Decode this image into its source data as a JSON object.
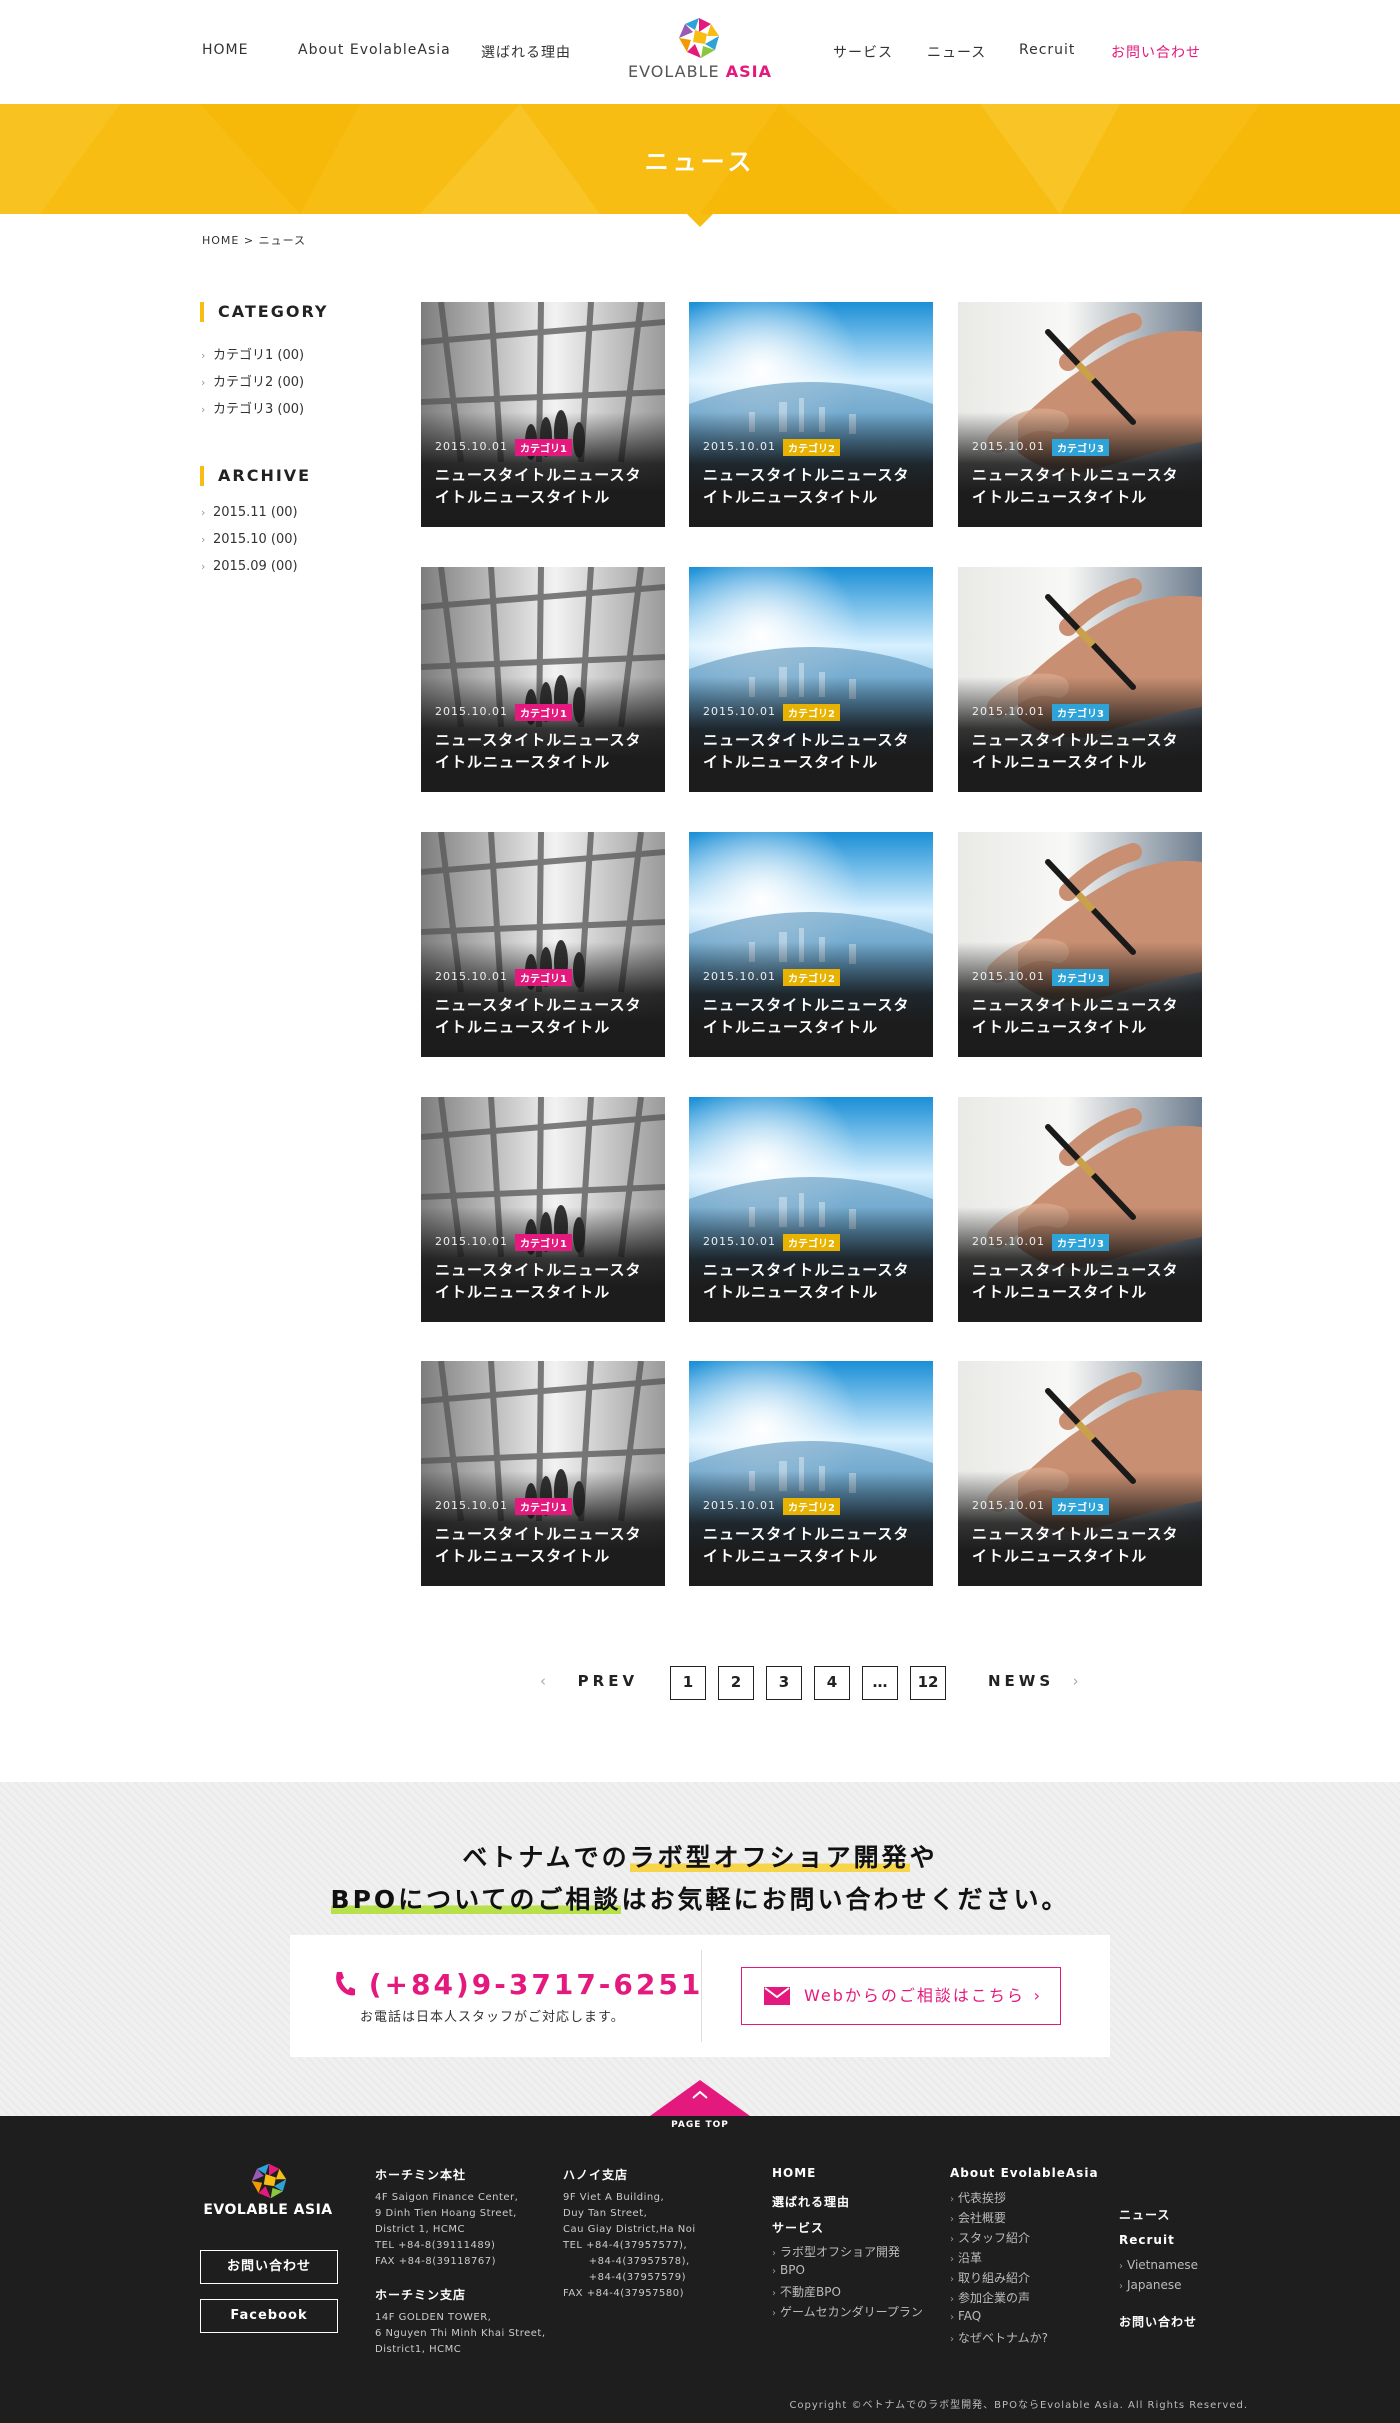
{
  "header": {
    "nav_left": [
      "HOME",
      "About EvolableAsia",
      "選ばれる理由"
    ],
    "nav_right": [
      "サービス",
      "ニュース",
      "Recruit",
      "お問い合わせ"
    ],
    "logo": {
      "text_main": "EVOLABLE",
      "text_accent": "ASIA"
    }
  },
  "hero": {
    "title": "ニュース"
  },
  "breadcrumb": "HOME > ニュース",
  "sidebar": {
    "category_title": "CATEGORY",
    "categories": [
      "カテゴリ1 (00)",
      "カテゴリ2 (00)",
      "カテゴリ3 (00)"
    ],
    "archive_title": "ARCHIVE",
    "archives": [
      "2015.11 (00)",
      "2015.10 (00)",
      "2015.09 (00)"
    ]
  },
  "news_item": {
    "date": "2015.10.01",
    "title": "ニュースタイトルニュースタイトルニュースタイトル",
    "tags": [
      "カテゴリ1",
      "カテゴリ2",
      "カテゴリ3"
    ],
    "tag_colors": [
      "#e4197d",
      "#e8b200",
      "#2ea3d8"
    ],
    "rows": 5
  },
  "pagination": {
    "prev": "PREV",
    "next": "NEWS",
    "pages": [
      "1",
      "2",
      "3",
      "4",
      "…",
      "12"
    ]
  },
  "contact": {
    "line1_a": "ベトナムでの",
    "line1_b": "ラボ型オフショア開発",
    "line1_c": "や",
    "line2_a": "BPOについてのご相談",
    "line2_b": "はお気軽にお問い合わせください。",
    "phone": "(+84)9-3717-6251",
    "phone_note": "お電話は日本人スタッフがご対応します。",
    "web_button": "Webからのご相談はこちら",
    "page_top": "PAGE TOP"
  },
  "footer": {
    "logo_text": "EVOLABLE ASIA",
    "contact_button": "お問い合わせ",
    "facebook_button": "Facebook",
    "hcm_head": "ホーチミン本社",
    "hcm_addr": "4F Saigon Finance Center,\n9 Dinh Tien Hoang Street,\nDistrict 1, HCMC\nTEL +84-8(39111489)\nFAX +84-8(39118767)",
    "hcm2_head": "ホーチミン支店",
    "hcm2_addr": "14F GOLDEN TOWER,\n6 Nguyen Thi Minh Khai Street,\nDistrict1, HCMC",
    "hanoi_head": "ハノイ支店",
    "hanoi_addr": "9F Viet A Building,\nDuy Tan Street,\nCau Giay District,Ha Noi\nTEL +84-4(37957577),\n       +84-4(37957578),\n       +84-4(37957579)\nFAX +84-4(37957580)",
    "col3_links": [
      "HOME",
      "選ばれる理由",
      "サービス"
    ],
    "service_items": [
      "ラボ型オフショア開発",
      "BPO",
      "不動産BPO",
      "ゲームセカンダリープラン"
    ],
    "about_head": "About EvolableAsia",
    "about_items": [
      "代表挨拶",
      "会社概要",
      "スタッフ紹介",
      "沿革",
      "取り組み紹介",
      "参加企業の声",
      "FAQ",
      "なぜベトナムか?"
    ],
    "col5_links": [
      "ニュース",
      "Recruit"
    ],
    "recruit_items": [
      "Vietnamese",
      "Japanese"
    ],
    "col5_contact": "お問い合わせ",
    "copyright": "Copyright ©ベトナムでのラボ型開発、BPOならEvolable Asia. All Rights Reserved."
  }
}
